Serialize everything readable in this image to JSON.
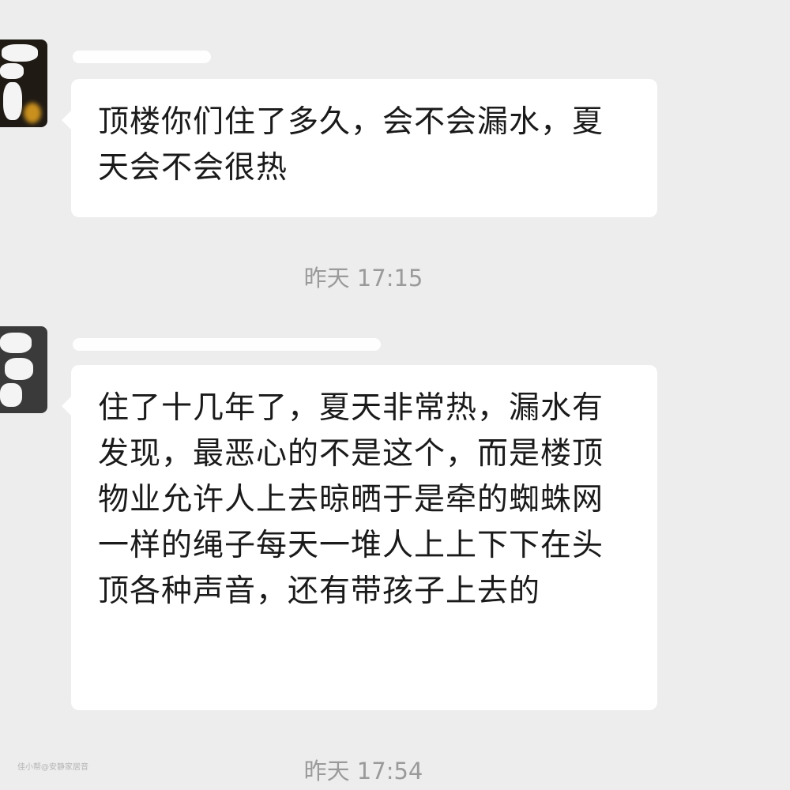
{
  "messages": [
    {
      "sender_name": "",
      "text": "顶楼你们住了多久，会不会漏水，夏天会不会很热"
    },
    {
      "sender_name": "",
      "text": "住了十几年了，夏天非常热，漏水有发现，最恶心的不是这个，而是楼顶物业允许人上去晾晒于是牵的蜘蛛网一样的绳子每天一堆人上上下下在头顶各种声音，还有带孩子上去的"
    }
  ],
  "timestamps": [
    "昨天 17:15",
    "昨天 17:54"
  ],
  "watermark": "佳小帮@安静家居音",
  "colors": {
    "background": "#ededed",
    "bubble": "#ffffff",
    "text": "#1a1a1a",
    "timestamp": "#9a9a9a"
  }
}
